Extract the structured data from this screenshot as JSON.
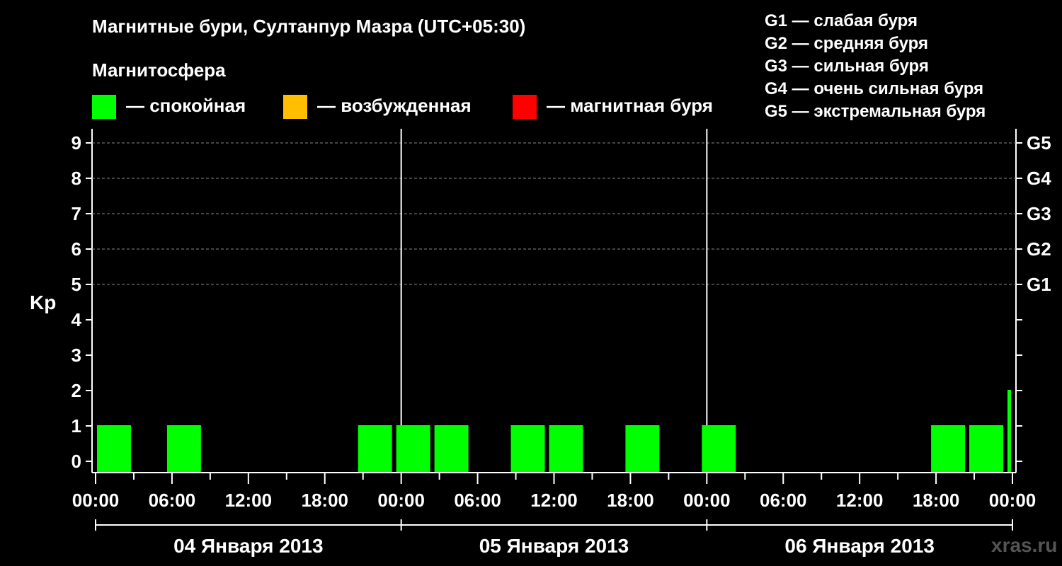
{
  "title": "Магнитные бури, Султанпур Мазра (UTC+05:30)",
  "legend": {
    "title": "Магнитосфера",
    "items": [
      {
        "color": "#00ff00",
        "label": "— спокойная"
      },
      {
        "color": "#ffbf00",
        "label": "— возбужденная"
      },
      {
        "color": "#ff0000",
        "label": "— магнитная буря"
      }
    ]
  },
  "storm_scale": [
    "G1 — слабая буря",
    "G2 — средняя буря",
    "G3 — сильная буря",
    "G4 — очень сильная буря",
    "G5 — экстремальная буря"
  ],
  "watermark": "xras.ru",
  "chart_data": {
    "type": "bar",
    "ylabel": "Kp",
    "ylim": [
      0,
      9
    ],
    "yticks": [
      0,
      1,
      2,
      3,
      4,
      5,
      6,
      7,
      8,
      9
    ],
    "right_ticks": [
      {
        "kp": 5,
        "label": "G1"
      },
      {
        "kp": 6,
        "label": "G2"
      },
      {
        "kp": 7,
        "label": "G3"
      },
      {
        "kp": 8,
        "label": "G4"
      },
      {
        "kp": 9,
        "label": "G5"
      }
    ],
    "x_tick_labels": [
      "00:00",
      "06:00",
      "12:00",
      "18:00",
      "00:00",
      "06:00",
      "12:00",
      "18:00",
      "00:00",
      "06:00",
      "12:00",
      "18:00",
      "00:00"
    ],
    "days": [
      "04 Января 2013",
      "05 Января 2013",
      "06 Января 2013"
    ],
    "grid": "dashed horizontal at Kp 5-9",
    "bars": [
      {
        "start_hour": 0.0,
        "kp": 1,
        "color": "#00ff00"
      },
      {
        "start_hour": 5.5,
        "kp": 1,
        "color": "#00ff00"
      },
      {
        "start_hour": 20.5,
        "kp": 1,
        "color": "#00ff00"
      },
      {
        "start_hour": 23.5,
        "kp": 1,
        "color": "#00ff00"
      },
      {
        "start_hour": 26.5,
        "kp": 1,
        "color": "#00ff00"
      },
      {
        "start_hour": 32.5,
        "kp": 1,
        "color": "#00ff00"
      },
      {
        "start_hour": 35.5,
        "kp": 1,
        "color": "#00ff00"
      },
      {
        "start_hour": 41.5,
        "kp": 1,
        "color": "#00ff00"
      },
      {
        "start_hour": 47.5,
        "kp": 1,
        "color": "#00ff00"
      },
      {
        "start_hour": 65.5,
        "kp": 1,
        "color": "#00ff00"
      },
      {
        "start_hour": 68.5,
        "kp": 1,
        "color": "#00ff00"
      },
      {
        "start_hour": 71.5,
        "kp": 2,
        "color": "#00ff00"
      }
    ]
  }
}
